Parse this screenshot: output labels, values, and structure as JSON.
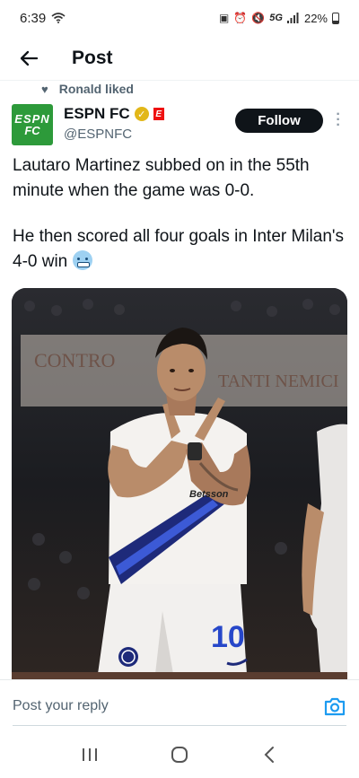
{
  "status": {
    "time": "6:39",
    "network": "5G",
    "battery": "22%"
  },
  "header": {
    "title": "Post"
  },
  "social_context": {
    "text": "Ronald liked"
  },
  "tweet": {
    "avatar_line1": "ESPN",
    "avatar_line2": "FC",
    "display_name": "ESPN FC",
    "brand_badge": "E",
    "handle": "@ESPNFC",
    "follow_label": "Follow",
    "text_para1": "Lautaro Martinez subbed on in the 55th minute when the game was 0-0.",
    "text_para2": "He then scored all four goals in Inter Milan's 4-0 win"
  },
  "media": {
    "jersey_text": "Betsson",
    "jersey_number": "10",
    "banner_text_1": "CONTRO",
    "banner_text_2": "TANTI NEMICI"
  },
  "reply": {
    "placeholder": "Post your reply"
  },
  "colors": {
    "follow_bg": "#0f1419",
    "accent_blue": "#1d9bf0",
    "avatar_green": "#2d9a3a",
    "muted_text": "#536471"
  }
}
